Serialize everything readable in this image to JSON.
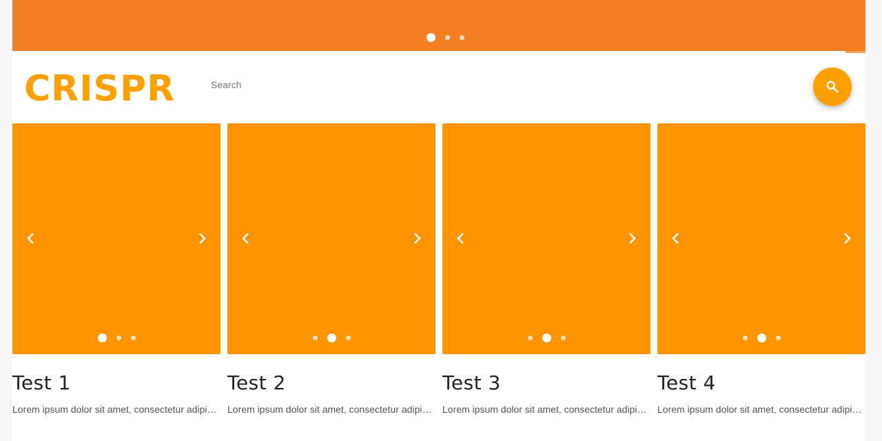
{
  "banner": {
    "color": "#f47e22",
    "active_slide": 1,
    "slide_count": 3
  },
  "header": {
    "logo": "CRISPR",
    "logo_color": "#ffa000",
    "search": {
      "placeholder": "Search",
      "value": ""
    },
    "search_button_icon": "search-icon"
  },
  "cards": {
    "media_color": "#ff9400",
    "prev_icon": "chevron-left-icon",
    "next_icon": "chevron-right-icon",
    "items": [
      {
        "title": "Test 1",
        "description": "Lorem ipsum dolor sit amet, consectetur adipiscing elit",
        "active_slide": 1,
        "slide_count": 3
      },
      {
        "title": "Test 2",
        "description": "Lorem ipsum dolor sit amet, consectetur adipiscing elit",
        "active_slide": 2,
        "slide_count": 3
      },
      {
        "title": "Test 3",
        "description": "Lorem ipsum dolor sit amet, consectetur adipiscing elit",
        "active_slide": 2,
        "slide_count": 3
      },
      {
        "title": "Test 4",
        "description": "Lorem ipsum dolor sit amet, consectetur adipiscing elit",
        "active_slide": 2,
        "slide_count": 3
      }
    ]
  }
}
